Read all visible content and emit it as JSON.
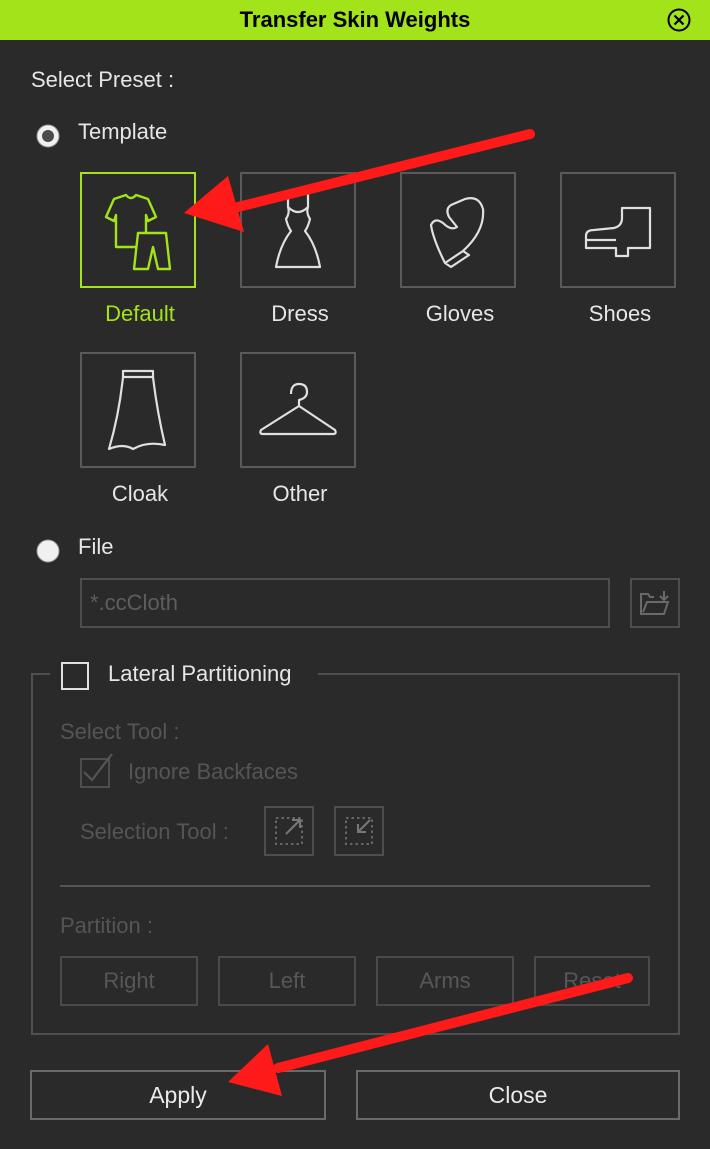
{
  "window": {
    "title": "Transfer Skin Weights",
    "close_icon": "close-circle-icon"
  },
  "preset": {
    "label": "Select Preset :",
    "template_label": "Template",
    "template_selected": true,
    "templates": [
      {
        "label": "Default",
        "icon": "clothes-icon",
        "selected": true
      },
      {
        "label": "Dress",
        "icon": "dress-icon",
        "selected": false
      },
      {
        "label": "Gloves",
        "icon": "glove-icon",
        "selected": false
      },
      {
        "label": "Shoes",
        "icon": "shoe-icon",
        "selected": false
      },
      {
        "label": "Cloak",
        "icon": "skirt-icon",
        "selected": false
      },
      {
        "label": "Other",
        "icon": "hanger-icon",
        "selected": false
      }
    ],
    "file_label": "File",
    "file_placeholder": "*.ccCloth",
    "file_browse_icon": "open-folder-icon"
  },
  "lateral": {
    "label": "Lateral Partitioning",
    "checked": false,
    "select_tool_label": "Select Tool :",
    "ignore_backfaces_label": "Ignore Backfaces",
    "ignore_backfaces_checked": true,
    "selection_tool_label": "Selection Tool :",
    "selection_tool_icons": [
      "select-expand-icon",
      "select-shrink-icon"
    ],
    "partition_label": "Partition :",
    "partition_buttons": [
      "Right",
      "Left",
      "Arms",
      "Reset"
    ]
  },
  "footer": {
    "apply": "Apply",
    "close": "Close"
  },
  "colors": {
    "accent": "#a2e31a",
    "background": "#2a2a2a",
    "annotation_arrow": "#ff1a1a"
  },
  "annotations": [
    "arrow-to-default",
    "arrow-to-apply"
  ]
}
